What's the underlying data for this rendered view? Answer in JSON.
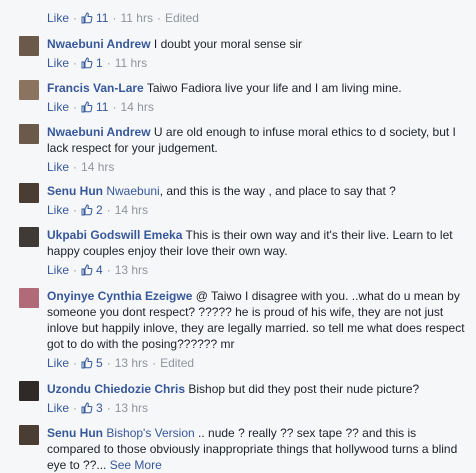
{
  "top_actions": {
    "like": "Like",
    "count": "11",
    "time": "11 hrs",
    "edited": "Edited"
  },
  "comments": [
    {
      "name": "Nwaebuni Andrew",
      "text": "I doubt your moral sense sir",
      "like": "Like",
      "count": "1",
      "time": "11 hrs",
      "avatar_color": "#6b5a4a"
    },
    {
      "name": "Francis Van-Lare",
      "text": "Taiwo Fadiora live your life and I am living mine.",
      "like": "Like",
      "count": "11",
      "time": "14 hrs",
      "avatar_color": "#8a7460"
    },
    {
      "name": "Nwaebuni Andrew",
      "text": "U are old enough to infuse moral ethics to d society, but I lack respect for your judgement.",
      "like": "Like",
      "time": "14 hrs",
      "avatar_color": "#6b5a4a"
    },
    {
      "name": "Senu Hun",
      "mention": "Nwaebuni",
      "text": ", and this is the way , and place to say that ?",
      "like": "Like",
      "count": "2",
      "time": "14 hrs",
      "avatar_color": "#4a3d33"
    },
    {
      "name": "Ukpabi Godswill Emeka",
      "text": "This is their own way and it's their live. Learn to let happy couples enjoy their love their own way.",
      "like": "Like",
      "count": "4",
      "time": "13 hrs",
      "avatar_color": "#3f3a36"
    },
    {
      "name": "Onyinye Cynthia Ezeigwe",
      "text": "@ Taiwo I disagree with you. ..what do u mean by someone you dont respect? ????? he is proud of his wife, they are not just inlove but happily inlove, they are legally married. so tell me what does respect got to do with the posing?????? mr",
      "like": "Like",
      "count": "5",
      "time": "13 hrs",
      "edited": "Edited",
      "avatar_color": "#b06a78"
    },
    {
      "name": "Uzondu Chiedozie Chris",
      "text": "Bishop but did they post their nude picture?",
      "like": "Like",
      "count": "3",
      "time": "13 hrs",
      "avatar_color": "#2f2a27"
    },
    {
      "name": "Senu Hun",
      "mention": "Bishop's Version",
      "text": ".. nude ? really ?? sex tape ?? and this is compared to those obviously inappropriate things that hollywood turns a blind eye to ??...",
      "see_more": "See More",
      "avatar_color": "#4a3d33"
    }
  ]
}
